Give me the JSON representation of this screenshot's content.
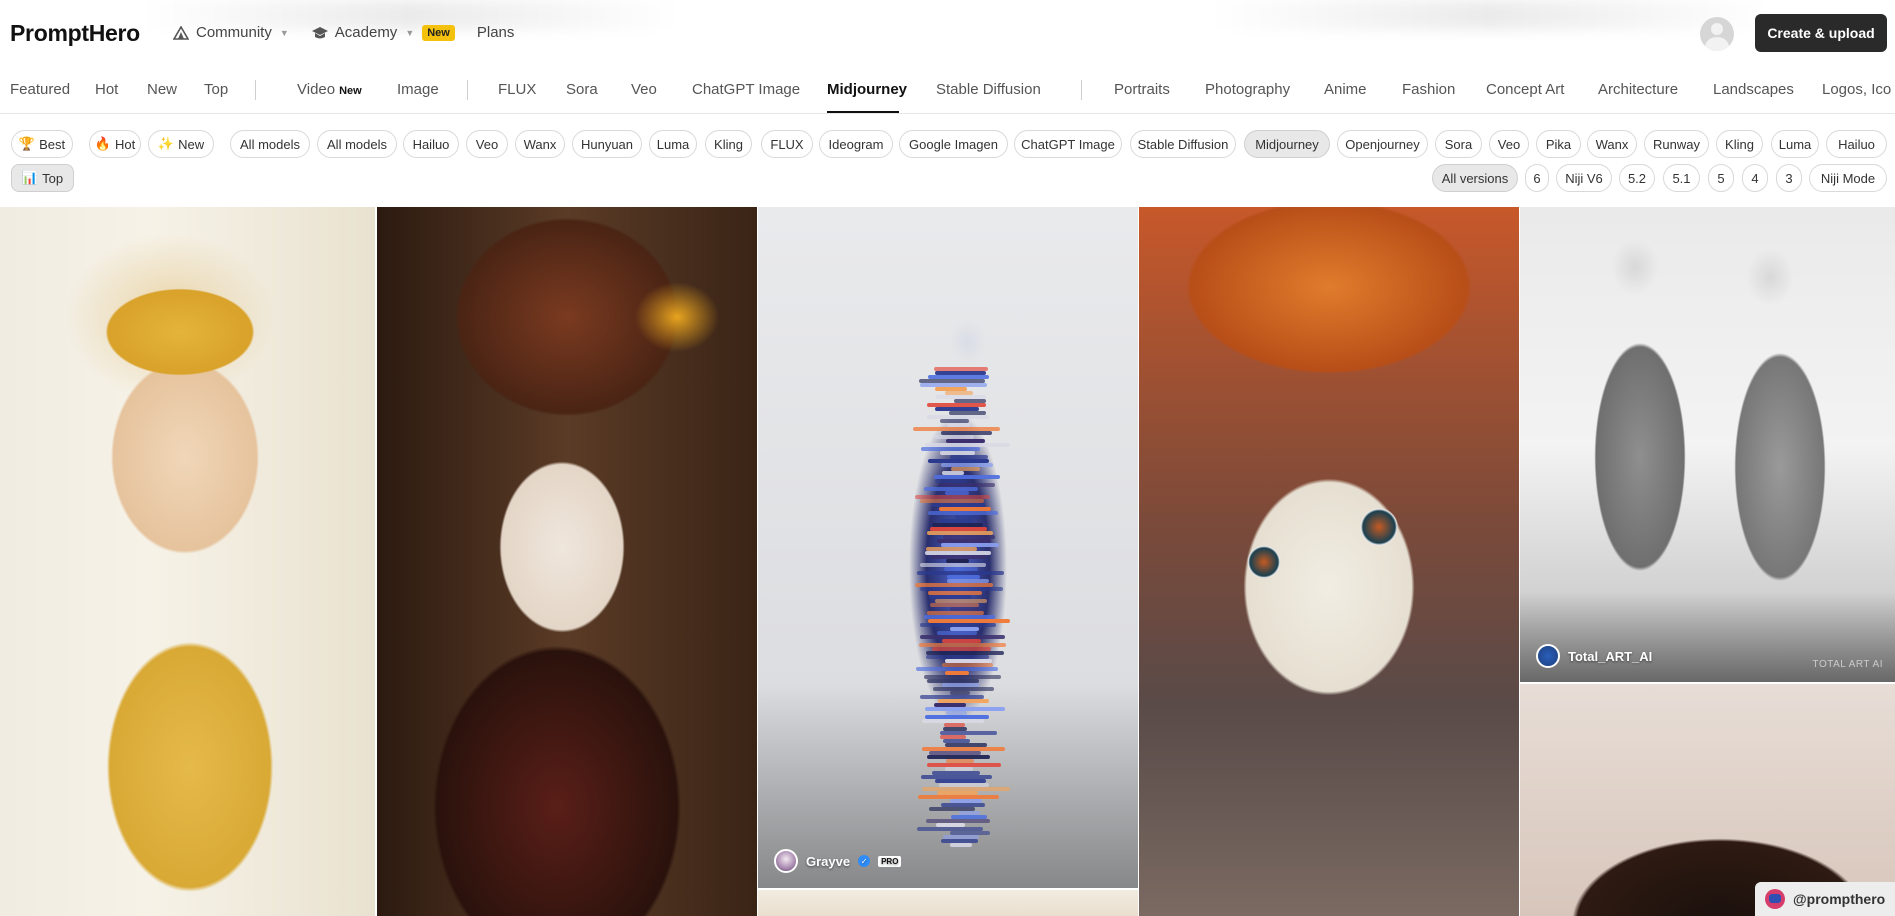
{
  "header": {
    "logo": "PromptHero",
    "nav": [
      {
        "label": "Community",
        "icon": "community-icon",
        "dropdown": true
      },
      {
        "label": "Academy",
        "icon": "graduation-cap-icon",
        "dropdown": true,
        "badge": "New"
      },
      {
        "label": "Plans"
      }
    ],
    "create_button": "Create & upload"
  },
  "categories": {
    "items": [
      "Featured",
      "Hot",
      "New",
      "Top",
      "Video",
      "Image",
      "FLUX",
      "Sora",
      "Veo",
      "ChatGPT Image",
      "Midjourney",
      "Stable Diffusion",
      "Portraits",
      "Photography",
      "Anime",
      "Fashion",
      "Concept Art",
      "Architecture",
      "Landscapes",
      "Logos, Ico"
    ],
    "video_tag": "New",
    "active": "Midjourney"
  },
  "filters": {
    "sort": [
      {
        "label": "Best",
        "icon": "trophy-icon"
      },
      {
        "label": "Hot",
        "icon": "fire-icon"
      },
      {
        "label": "New",
        "icon": "sparkle-icon"
      },
      {
        "label": "Top",
        "icon": "ranking-icon"
      }
    ],
    "models": [
      "All models",
      "All models",
      "Hailuo",
      "Veo",
      "Wanx",
      "Hunyuan",
      "Luma",
      "Kling",
      "FLUX",
      "Ideogram",
      "Google Imagen",
      "ChatGPT Image",
      "Stable Diffusion",
      "Midjourney",
      "Openjourney",
      "Sora",
      "Veo",
      "Pika",
      "Wanx",
      "Runway",
      "Kling",
      "Luma",
      "Hailuo"
    ],
    "selected_model": "Midjourney",
    "versions": [
      "All versions",
      "6",
      "Niji V6",
      "5.2",
      "5.1",
      "5",
      "4",
      "3",
      "Niji Mode"
    ],
    "selected_version": "All versions"
  },
  "gallery": {
    "tiles": [
      {
        "user": ""
      },
      {
        "user": ""
      },
      {
        "user": "Grayve",
        "verified": true,
        "pro": "PRO"
      },
      {
        "user": ""
      },
      {
        "user": "Total_ART_AI",
        "watermark": "TOTAL ART AI"
      },
      {
        "user": ""
      }
    ]
  },
  "footer_handle": "@prompthero",
  "colors": {
    "primary_button": "#2a2a2a",
    "badge_new": "#f4c20d",
    "verified": "#2f8cf7"
  }
}
